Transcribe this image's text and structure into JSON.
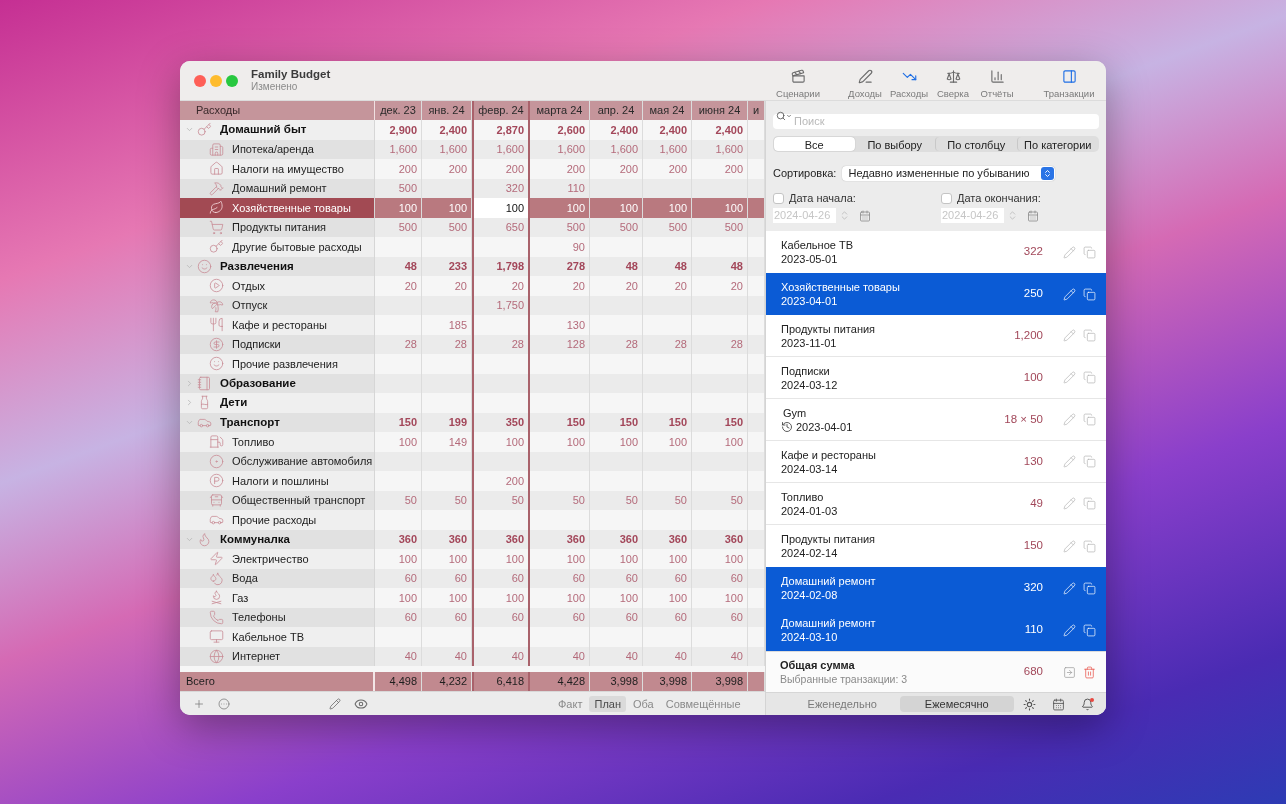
{
  "window": {
    "title": "Family Budget",
    "subtitle": "Изменено"
  },
  "toolbar": [
    {
      "label": "Сценарии",
      "selected": false
    },
    {
      "label": "Доходы",
      "selected": false
    },
    {
      "label": "Расходы",
      "selected": true
    },
    {
      "label": "Сверка",
      "selected": false
    },
    {
      "label": "Отчёты",
      "selected": false
    },
    {
      "label": "Транзакции",
      "selected": true
    }
  ],
  "table": {
    "name_header": "Расходы",
    "columns": [
      {
        "label": "дек. 23",
        "selected": false
      },
      {
        "label": "янв. 24",
        "selected": false
      },
      {
        "label": "февр. 24",
        "selected": true
      },
      {
        "label": "марта 24",
        "selected": false
      },
      {
        "label": "апр. 24",
        "selected": false
      },
      {
        "label": "мая 24",
        "selected": false
      },
      {
        "label": "июня 24",
        "selected": false
      },
      {
        "label": "и",
        "selected": false
      }
    ],
    "rows": [
      {
        "name": "Домашний быт",
        "expanded": true,
        "selected": false,
        "cells": [
          {
            "kind": "amount",
            "text": "2,900"
          },
          {
            "kind": "amount",
            "text": "2,400"
          },
          {
            "kind": "amount",
            "text": "2,870"
          },
          {
            "kind": "amount",
            "text": "2,600"
          },
          {
            "kind": "amount",
            "text": "2,400"
          },
          {
            "kind": "amount",
            "text": "2,400"
          },
          {
            "kind": "amount",
            "text": "2,400"
          }
        ],
        "children": [
          {
            "name": "Ипотека/аренда",
            "selected": false,
            "cells": [
              {
                "kind": "amount",
                "text": "1,600"
              },
              {
                "kind": "amount",
                "text": "1,600"
              },
              {
                "kind": "amount",
                "text": "1,600"
              },
              {
                "kind": "amount",
                "text": "1,600"
              },
              {
                "kind": "amount",
                "text": "1,600"
              },
              {
                "kind": "amount",
                "text": "1,600"
              },
              {
                "kind": "amount",
                "text": "1,600"
              }
            ]
          },
          {
            "name": "Налоги на имущество",
            "selected": false,
            "cells": [
              {
                "kind": "amount",
                "text": "200"
              },
              {
                "kind": "amount",
                "text": "200"
              },
              {
                "kind": "amount",
                "text": "200"
              },
              {
                "kind": "amount",
                "text": "200"
              },
              {
                "kind": "amount",
                "text": "200"
              },
              {
                "kind": "amount",
                "text": "200"
              },
              {
                "kind": "amount",
                "text": "200"
              }
            ]
          },
          {
            "name": "Домашний ремонт",
            "selected": false,
            "cells": [
              {
                "kind": "amount",
                "text": "500"
              },
              {
                "kind": "blank"
              },
              {
                "kind": "amount",
                "text": "320"
              },
              {
                "kind": "amount",
                "text": "110"
              },
              {
                "kind": "blank"
              },
              {
                "kind": "blank"
              },
              {
                "kind": "blank"
              }
            ]
          },
          {
            "name": "Хозяйственные товары",
            "selected": true,
            "cells": [
              {
                "kind": "amount",
                "text": "100"
              },
              {
                "kind": "amount",
                "text": "100"
              },
              {
                "kind": "amount",
                "text": "100"
              },
              {
                "kind": "amount",
                "text": "100"
              },
              {
                "kind": "amount",
                "text": "100"
              },
              {
                "kind": "amount",
                "text": "100"
              },
              {
                "kind": "amount",
                "text": "100"
              }
            ]
          },
          {
            "name": "Продукты питания",
            "selected": false,
            "cells": [
              {
                "kind": "amount",
                "text": "500"
              },
              {
                "kind": "amount",
                "text": "500"
              },
              {
                "kind": "amount",
                "text": "650"
              },
              {
                "kind": "amount",
                "text": "500"
              },
              {
                "kind": "amount",
                "text": "500"
              },
              {
                "kind": "amount",
                "text": "500"
              },
              {
                "kind": "amount",
                "text": "500"
              }
            ]
          },
          {
            "name": "Другие бытовые расходы",
            "selected": false,
            "cells": [
              {
                "kind": "blank"
              },
              {
                "kind": "blank"
              },
              {
                "kind": "blank"
              },
              {
                "kind": "amount",
                "text": "90"
              },
              {
                "kind": "blank"
              },
              {
                "kind": "blank"
              },
              {
                "kind": "blank"
              }
            ]
          }
        ]
      },
      {
        "name": "Развлечения",
        "expanded": true,
        "selected": false,
        "cells": [
          {
            "kind": "amount",
            "text": "48"
          },
          {
            "kind": "amount",
            "text": "233"
          },
          {
            "kind": "amount",
            "text": "1,798"
          },
          {
            "kind": "amount",
            "text": "278"
          },
          {
            "kind": "amount",
            "text": "48"
          },
          {
            "kind": "amount",
            "text": "48"
          },
          {
            "kind": "amount",
            "text": "48"
          }
        ],
        "children": [
          {
            "name": "Отдых",
            "selected": false,
            "cells": [
              {
                "kind": "amount",
                "text": "20"
              },
              {
                "kind": "amount",
                "text": "20"
              },
              {
                "kind": "amount",
                "text": "20"
              },
              {
                "kind": "amount",
                "text": "20"
              },
              {
                "kind": "amount",
                "text": "20"
              },
              {
                "kind": "amount",
                "text": "20"
              },
              {
                "kind": "amount",
                "text": "20"
              }
            ]
          },
          {
            "name": "Отпуск",
            "selected": false,
            "cells": [
              {
                "kind": "blank"
              },
              {
                "kind": "blank"
              },
              {
                "kind": "amount",
                "text": "1,750"
              },
              {
                "kind": "blank"
              },
              {
                "kind": "blank"
              },
              {
                "kind": "blank"
              },
              {
                "kind": "blank"
              }
            ]
          },
          {
            "name": "Кафе и рестораны",
            "selected": false,
            "cells": [
              {
                "kind": "blank"
              },
              {
                "kind": "amount",
                "text": "185"
              },
              {
                "kind": "blank"
              },
              {
                "kind": "amount",
                "text": "130"
              },
              {
                "kind": "blank"
              },
              {
                "kind": "blank"
              },
              {
                "kind": "blank"
              }
            ]
          },
          {
            "name": "Подписки",
            "selected": false,
            "cells": [
              {
                "kind": "amount",
                "text": "28"
              },
              {
                "kind": "amount",
                "text": "28"
              },
              {
                "kind": "amount",
                "text": "28"
              },
              {
                "kind": "amount",
                "text": "128"
              },
              {
                "kind": "amount",
                "text": "28"
              },
              {
                "kind": "amount",
                "text": "28"
              },
              {
                "kind": "amount",
                "text": "28"
              }
            ]
          },
          {
            "name": "Прочие развлечения",
            "selected": false
          }
        ]
      },
      {
        "name": "Образование",
        "expanded": false,
        "selected": false
      },
      {
        "name": "Дети",
        "expanded": false,
        "selected": false
      },
      {
        "name": "Транспорт",
        "expanded": true,
        "selected": false,
        "cells": [
          {
            "kind": "amount",
            "text": "150"
          },
          {
            "kind": "amount",
            "text": "199"
          },
          {
            "kind": "amount",
            "text": "350"
          },
          {
            "kind": "amount",
            "text": "150"
          },
          {
            "kind": "amount",
            "text": "150"
          },
          {
            "kind": "amount",
            "text": "150"
          },
          {
            "kind": "amount",
            "text": "150"
          }
        ],
        "children": [
          {
            "name": "Топливо",
            "selected": false,
            "cells": [
              {
                "kind": "amount",
                "text": "100"
              },
              {
                "kind": "amount",
                "text": "149"
              },
              {
                "kind": "amount",
                "text": "100"
              },
              {
                "kind": "amount",
                "text": "100"
              },
              {
                "kind": "amount",
                "text": "100"
              },
              {
                "kind": "amount",
                "text": "100"
              },
              {
                "kind": "amount",
                "text": "100"
              }
            ]
          },
          {
            "name": "Обслуживание автомобиля",
            "selected": false
          },
          {
            "name": "Налоги и пошлины",
            "selected": false,
            "cells": [
              {
                "kind": "blank"
              },
              {
                "kind": "blank"
              },
              {
                "kind": "amount",
                "text": "200"
              },
              {
                "kind": "blank"
              },
              {
                "kind": "blank"
              },
              {
                "kind": "blank"
              },
              {
                "kind": "blank"
              }
            ]
          },
          {
            "name": "Общественный транспорт",
            "selected": false,
            "cells": [
              {
                "kind": "amount",
                "text": "50"
              },
              {
                "kind": "amount",
                "text": "50"
              },
              {
                "kind": "amount",
                "text": "50"
              },
              {
                "kind": "amount",
                "text": "50"
              },
              {
                "kind": "amount",
                "text": "50"
              },
              {
                "kind": "amount",
                "text": "50"
              },
              {
                "kind": "amount",
                "text": "50"
              }
            ]
          },
          {
            "name": "Прочие расходы",
            "selected": false
          }
        ]
      },
      {
        "name": "Коммуналка",
        "expanded": true,
        "selected": false,
        "cells": [
          {
            "kind": "amount",
            "text": "360"
          },
          {
            "kind": "amount",
            "text": "360"
          },
          {
            "kind": "amount",
            "text": "360"
          },
          {
            "kind": "amount",
            "text": "360"
          },
          {
            "kind": "amount",
            "text": "360"
          },
          {
            "kind": "amount",
            "text": "360"
          },
          {
            "kind": "amount",
            "text": "360"
          }
        ],
        "children": [
          {
            "name": "Электричество",
            "selected": false,
            "cells": [
              {
                "kind": "amount",
                "text": "100"
              },
              {
                "kind": "amount",
                "text": "100"
              },
              {
                "kind": "amount",
                "text": "100"
              },
              {
                "kind": "amount",
                "text": "100"
              },
              {
                "kind": "amount",
                "text": "100"
              },
              {
                "kind": "amount",
                "text": "100"
              },
              {
                "kind": "amount",
                "text": "100"
              }
            ]
          },
          {
            "name": "Вода",
            "selected": false,
            "cells": [
              {
                "kind": "amount",
                "text": "60"
              },
              {
                "kind": "amount",
                "text": "60"
              },
              {
                "kind": "amount",
                "text": "60"
              },
              {
                "kind": "amount",
                "text": "60"
              },
              {
                "kind": "amount",
                "text": "60"
              },
              {
                "kind": "amount",
                "text": "60"
              },
              {
                "kind": "amount",
                "text": "60"
              }
            ]
          },
          {
            "name": "Газ",
            "selected": false,
            "cells": [
              {
                "kind": "amount",
                "text": "100"
              },
              {
                "kind": "amount",
                "text": "100"
              },
              {
                "kind": "amount",
                "text": "100"
              },
              {
                "kind": "amount",
                "text": "100"
              },
              {
                "kind": "amount",
                "text": "100"
              },
              {
                "kind": "amount",
                "text": "100"
              },
              {
                "kind": "amount",
                "text": "100"
              }
            ]
          },
          {
            "name": "Телефоны",
            "selected": false,
            "cells": [
              {
                "kind": "amount",
                "text": "60"
              },
              {
                "kind": "amount",
                "text": "60"
              },
              {
                "kind": "amount",
                "text": "60"
              },
              {
                "kind": "amount",
                "text": "60"
              },
              {
                "kind": "amount",
                "text": "60"
              },
              {
                "kind": "amount",
                "text": "60"
              },
              {
                "kind": "amount",
                "text": "60"
              }
            ]
          },
          {
            "name": "Кабельное ТВ",
            "selected": false
          },
          {
            "name": "Интернет",
            "selected": false,
            "cells": [
              {
                "kind": "amount",
                "text": "40"
              },
              {
                "kind": "amount",
                "text": "40"
              },
              {
                "kind": "amount",
                "text": "40"
              },
              {
                "kind": "amount",
                "text": "40"
              },
              {
                "kind": "amount",
                "text": "40"
              },
              {
                "kind": "amount",
                "text": "40"
              },
              {
                "kind": "amount",
                "text": "40"
              }
            ]
          }
        ]
      }
    ],
    "total": {
      "label": "Всего",
      "values": [
        "4,498",
        "4,232",
        "6,418",
        "4,428",
        "3,998",
        "3,998",
        "3,998"
      ]
    }
  },
  "view_modes": [
    {
      "label": "Факт",
      "selected": false
    },
    {
      "label": "План",
      "selected": true
    },
    {
      "label": "Оба",
      "selected": false
    },
    {
      "label": "Совмещённые",
      "selected": false
    }
  ],
  "transactions": {
    "search": {
      "placeholder": "Поиск"
    },
    "filters": [
      {
        "label": "Все",
        "selected": true
      },
      {
        "label": "По выбору",
        "selected": false
      },
      {
        "label": "По столбцу",
        "selected": false
      },
      {
        "label": "По категории",
        "selected": false
      }
    ],
    "sort": {
      "label": "Сортировка:",
      "value": "Недавно измененные по убыванию"
    },
    "date_filters": [
      {
        "label": "Дата начала:",
        "checked": false,
        "value": "2024-04-26"
      },
      {
        "label": "Дата окончания:",
        "checked": false,
        "value": "2024-04-26"
      }
    ],
    "items": [
      {
        "name": "Кабельное ТВ",
        "date": "2023-05-01",
        "amount": "322",
        "recurring": false,
        "selected": false
      },
      {
        "name": "Хозяйственные товары",
        "date": "2023-04-01",
        "amount": "250",
        "recurring": false,
        "selected": true
      },
      {
        "name": "Продукты питания",
        "date": "2023-11-01",
        "amount": "1,200",
        "recurring": false,
        "selected": false
      },
      {
        "name": "Подписки",
        "date": "2024-03-12",
        "amount": "100",
        "recurring": false,
        "selected": false
      },
      {
        "name": "Gym",
        "date": "2023-04-01",
        "amount": "18 × 50",
        "recurring": true,
        "selected": false
      },
      {
        "name": "Кафе и рестораны",
        "date": "2024-03-14",
        "amount": "130",
        "recurring": false,
        "selected": false
      },
      {
        "name": "Топливо",
        "date": "2024-01-03",
        "amount": "49",
        "recurring": false,
        "selected": false
      },
      {
        "name": "Продукты питания",
        "date": "2024-02-14",
        "amount": "150",
        "recurring": false,
        "selected": false
      },
      {
        "name": "Домашний ремонт",
        "date": "2024-02-08",
        "amount": "320",
        "recurring": false,
        "selected": true
      },
      {
        "name": "Домашний ремонт",
        "date": "2024-03-10",
        "amount": "110",
        "recurring": false,
        "selected": true
      }
    ],
    "summary": {
      "title": "Общая сумма",
      "subtitle": "Выбранные транзакции: 3",
      "amount": "680"
    },
    "periods": [
      {
        "label": "Еженедельно",
        "selected": false
      },
      {
        "label": "Ежемесячно",
        "selected": true
      }
    ]
  }
}
